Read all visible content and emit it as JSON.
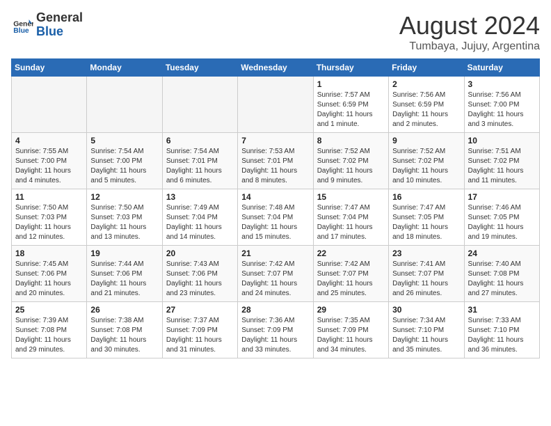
{
  "header": {
    "logo_line1": "General",
    "logo_line2": "Blue",
    "month": "August 2024",
    "location": "Tumbaya, Jujuy, Argentina"
  },
  "weekdays": [
    "Sunday",
    "Monday",
    "Tuesday",
    "Wednesday",
    "Thursday",
    "Friday",
    "Saturday"
  ],
  "weeks": [
    [
      {
        "day": "",
        "empty": true
      },
      {
        "day": "",
        "empty": true
      },
      {
        "day": "",
        "empty": true
      },
      {
        "day": "",
        "empty": true
      },
      {
        "day": "1",
        "sunrise": "7:57 AM",
        "sunset": "6:59 PM",
        "daylight": "11 hours and 1 minute."
      },
      {
        "day": "2",
        "sunrise": "7:56 AM",
        "sunset": "6:59 PM",
        "daylight": "11 hours and 2 minutes."
      },
      {
        "day": "3",
        "sunrise": "7:56 AM",
        "sunset": "7:00 PM",
        "daylight": "11 hours and 3 minutes."
      }
    ],
    [
      {
        "day": "4",
        "sunrise": "7:55 AM",
        "sunset": "7:00 PM",
        "daylight": "11 hours and 4 minutes."
      },
      {
        "day": "5",
        "sunrise": "7:54 AM",
        "sunset": "7:00 PM",
        "daylight": "11 hours and 5 minutes."
      },
      {
        "day": "6",
        "sunrise": "7:54 AM",
        "sunset": "7:01 PM",
        "daylight": "11 hours and 6 minutes."
      },
      {
        "day": "7",
        "sunrise": "7:53 AM",
        "sunset": "7:01 PM",
        "daylight": "11 hours and 8 minutes."
      },
      {
        "day": "8",
        "sunrise": "7:52 AM",
        "sunset": "7:02 PM",
        "daylight": "11 hours and 9 minutes."
      },
      {
        "day": "9",
        "sunrise": "7:52 AM",
        "sunset": "7:02 PM",
        "daylight": "11 hours and 10 minutes."
      },
      {
        "day": "10",
        "sunrise": "7:51 AM",
        "sunset": "7:02 PM",
        "daylight": "11 hours and 11 minutes."
      }
    ],
    [
      {
        "day": "11",
        "sunrise": "7:50 AM",
        "sunset": "7:03 PM",
        "daylight": "11 hours and 12 minutes."
      },
      {
        "day": "12",
        "sunrise": "7:50 AM",
        "sunset": "7:03 PM",
        "daylight": "11 hours and 13 minutes."
      },
      {
        "day": "13",
        "sunrise": "7:49 AM",
        "sunset": "7:04 PM",
        "daylight": "11 hours and 14 minutes."
      },
      {
        "day": "14",
        "sunrise": "7:48 AM",
        "sunset": "7:04 PM",
        "daylight": "11 hours and 15 minutes."
      },
      {
        "day": "15",
        "sunrise": "7:47 AM",
        "sunset": "7:04 PM",
        "daylight": "11 hours and 17 minutes."
      },
      {
        "day": "16",
        "sunrise": "7:47 AM",
        "sunset": "7:05 PM",
        "daylight": "11 hours and 18 minutes."
      },
      {
        "day": "17",
        "sunrise": "7:46 AM",
        "sunset": "7:05 PM",
        "daylight": "11 hours and 19 minutes."
      }
    ],
    [
      {
        "day": "18",
        "sunrise": "7:45 AM",
        "sunset": "7:06 PM",
        "daylight": "11 hours and 20 minutes."
      },
      {
        "day": "19",
        "sunrise": "7:44 AM",
        "sunset": "7:06 PM",
        "daylight": "11 hours and 21 minutes."
      },
      {
        "day": "20",
        "sunrise": "7:43 AM",
        "sunset": "7:06 PM",
        "daylight": "11 hours and 23 minutes."
      },
      {
        "day": "21",
        "sunrise": "7:42 AM",
        "sunset": "7:07 PM",
        "daylight": "11 hours and 24 minutes."
      },
      {
        "day": "22",
        "sunrise": "7:42 AM",
        "sunset": "7:07 PM",
        "daylight": "11 hours and 25 minutes."
      },
      {
        "day": "23",
        "sunrise": "7:41 AM",
        "sunset": "7:07 PM",
        "daylight": "11 hours and 26 minutes."
      },
      {
        "day": "24",
        "sunrise": "7:40 AM",
        "sunset": "7:08 PM",
        "daylight": "11 hours and 27 minutes."
      }
    ],
    [
      {
        "day": "25",
        "sunrise": "7:39 AM",
        "sunset": "7:08 PM",
        "daylight": "11 hours and 29 minutes."
      },
      {
        "day": "26",
        "sunrise": "7:38 AM",
        "sunset": "7:08 PM",
        "daylight": "11 hours and 30 minutes."
      },
      {
        "day": "27",
        "sunrise": "7:37 AM",
        "sunset": "7:09 PM",
        "daylight": "11 hours and 31 minutes."
      },
      {
        "day": "28",
        "sunrise": "7:36 AM",
        "sunset": "7:09 PM",
        "daylight": "11 hours and 33 minutes."
      },
      {
        "day": "29",
        "sunrise": "7:35 AM",
        "sunset": "7:09 PM",
        "daylight": "11 hours and 34 minutes."
      },
      {
        "day": "30",
        "sunrise": "7:34 AM",
        "sunset": "7:10 PM",
        "daylight": "11 hours and 35 minutes."
      },
      {
        "day": "31",
        "sunrise": "7:33 AM",
        "sunset": "7:10 PM",
        "daylight": "11 hours and 36 minutes."
      }
    ]
  ]
}
